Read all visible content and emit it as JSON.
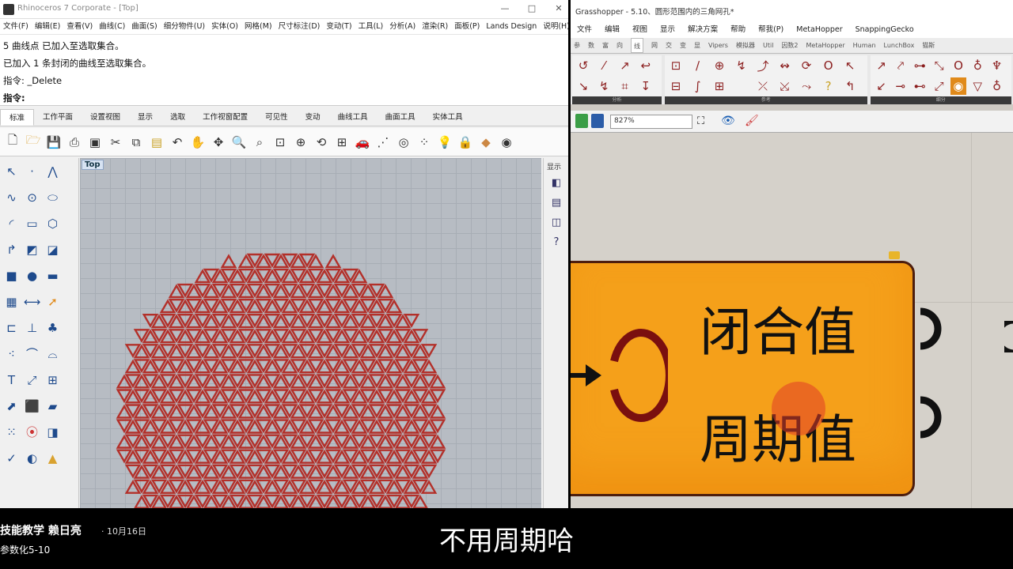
{
  "rhino": {
    "title": "Rhinoceros 7 Corporate - [Top]",
    "menu": [
      "文件(F)",
      "编辑(E)",
      "查看(V)",
      "曲线(C)",
      "曲面(S)",
      "细分物件(U)",
      "实体(O)",
      "网格(M)",
      "尺寸标注(D)",
      "变动(T)",
      "工具(L)",
      "分析(A)",
      "渲染(R)",
      "面板(P)",
      "Lands Design",
      "说明(H)"
    ],
    "command_lines": [
      "5 曲线点 已加入至选取集合。",
      "已加入 1 条封闭的曲线至选取集合。",
      "指令: _Delete"
    ],
    "prompt": "指令:",
    "tabs": [
      "标准",
      "工作平面",
      "设置视图",
      "显示",
      "选取",
      "工作视窗配置",
      "可见性",
      "变动",
      "曲线工具",
      "曲面工具",
      "实体工具"
    ],
    "active_tab": "标准",
    "viewport_label": "Top",
    "right_panel_label": "显示"
  },
  "grasshopper": {
    "title": "Grasshopper - 5.10、圆形范围内的三角网孔*",
    "menu": [
      "文件",
      "编辑",
      "视图",
      "显示",
      "解决方案",
      "帮助",
      "帮我(P)",
      "MetaHopper",
      "SnappingGecko"
    ],
    "tabs": [
      "参",
      "数",
      "富",
      "向",
      "线",
      "网",
      "交",
      "变",
      "显",
      "Vipers",
      "模拟器",
      "Util",
      "因数2",
      "MetaHopper",
      "Human",
      "LunchBox",
      "猫斯"
    ],
    "active_tab": "线",
    "ribbon_groups": [
      "分析",
      "参考",
      "细分"
    ],
    "zoom": "827%",
    "component": {
      "label_closed": "闭合值",
      "label_period": "周期值"
    }
  },
  "bottom": {
    "channel": "技能教学 赖日亮",
    "date": "· 10月16日",
    "series": "参数化5-10",
    "subtitle": "不用周期哈"
  },
  "colors": {
    "component_fill": "#f5a01a",
    "component_border": "#4d1e0e",
    "curve": "#b3302a",
    "viewport_bg": "#b7bcc3"
  }
}
